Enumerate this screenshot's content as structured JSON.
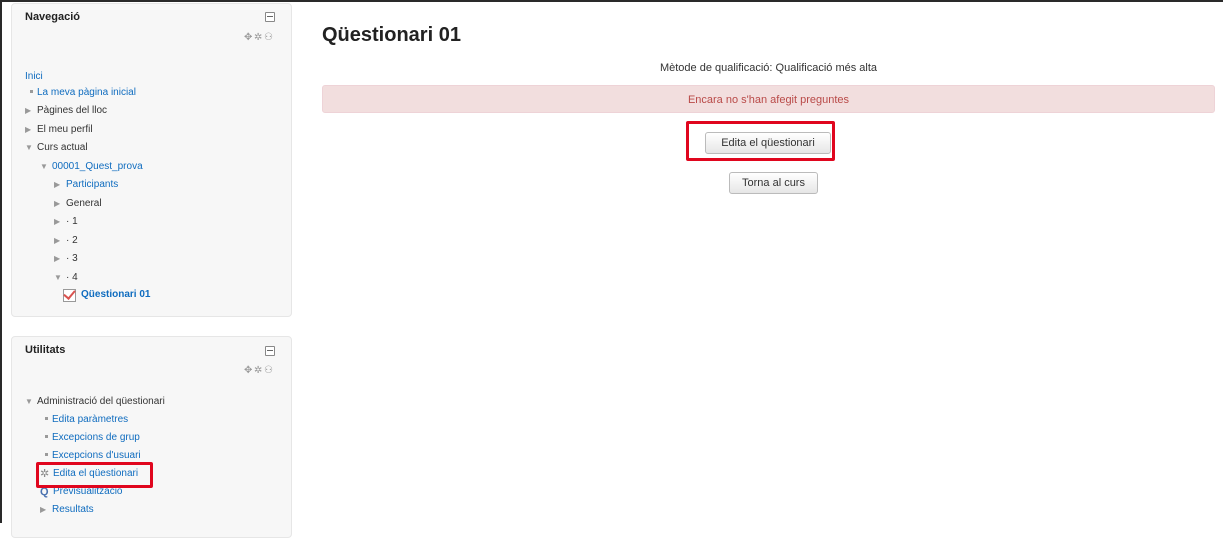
{
  "navigation": {
    "title": "Navegació",
    "items": [
      {
        "label": "Inici"
      },
      {
        "label": "La meva pàgina inicial"
      },
      {
        "label": "Pàgines del lloc"
      },
      {
        "label": "El meu perfil"
      },
      {
        "label": "Curs actual"
      },
      {
        "label": "00001_Quest_prova"
      },
      {
        "label": "Participants"
      },
      {
        "label": "General"
      },
      {
        "label": "· 1"
      },
      {
        "label": "· 2"
      },
      {
        "label": "· 3"
      },
      {
        "label": "· 4"
      },
      {
        "label": "Qüestionari 01"
      }
    ]
  },
  "utilities": {
    "title": "Utilitats",
    "items": [
      {
        "label": "Administració del qüestionari"
      },
      {
        "label": "Edita paràmetres"
      },
      {
        "label": "Excepcions de grup"
      },
      {
        "label": "Excepcions d'usuari"
      },
      {
        "label": "Edita el qüestionari"
      },
      {
        "label": "Previsualització"
      },
      {
        "label": "Resultats"
      }
    ]
  },
  "main": {
    "title": "Qüestionari 01",
    "grading_method": "Mètode de qualificació: Qualificació més alta",
    "alert": "Encara no s'han afegit preguntes",
    "edit_button": "Edita el qüestionari",
    "back_button": "Torna al curs"
  },
  "icons": {
    "collapse": "collapse-icon",
    "move": "move-icon",
    "configure": "gear-icon",
    "assign_roles": "assign-roles-icon"
  },
  "colors": {
    "link": "#0f6cbf",
    "alert_bg": "#f2dede",
    "alert_text": "#b94a48",
    "highlight": "#e0061e"
  }
}
